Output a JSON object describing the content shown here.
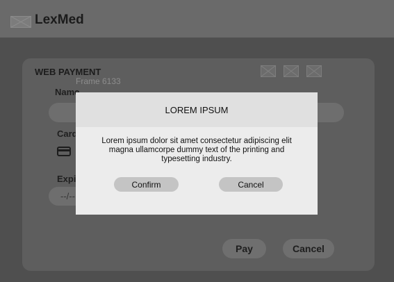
{
  "app": {
    "brand": "LexMed"
  },
  "card": {
    "title": "WEB PAYMENT",
    "subtitle": "Frame 6133",
    "icons": [
      "image-placeholder-icon",
      "image-placeholder-icon",
      "image-placeholder-icon"
    ],
    "fields": {
      "name_label": "Name",
      "card_number_label": "Card Number",
      "expiry_label": "Expiry",
      "expiry_placeholder": "--/--",
      "cvv_placeholder": "***"
    },
    "buttons": {
      "pay": "Pay",
      "cancel": "Cancel"
    }
  },
  "modal": {
    "title": "LOREM IPSUM",
    "body": "Lorem ipsum dolor sit amet consectetur adipiscing elit magna ullamcorpe dummy text of the printing and typesetting industry.",
    "confirm": "Confirm",
    "cancel": "Cancel"
  },
  "colors": {
    "overlay_background": "#4f4f4f",
    "modal_background": "#ececec",
    "button_background": "#c4c4c4"
  }
}
